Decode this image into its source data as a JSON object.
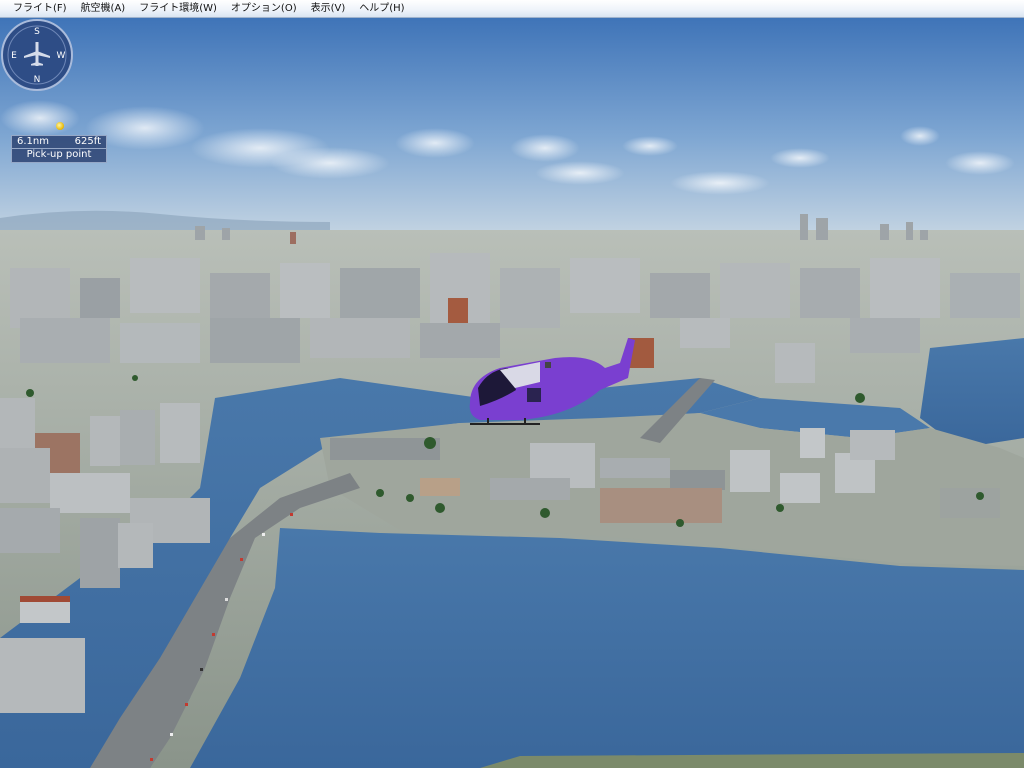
{
  "menubar": {
    "items": [
      {
        "label": "フライト(F)"
      },
      {
        "label": "航空機(A)"
      },
      {
        "label": "フライト環境(W)"
      },
      {
        "label": "オプション(O)"
      },
      {
        "label": "表示(V)"
      },
      {
        "label": "ヘルプ(H)"
      }
    ]
  },
  "hud": {
    "distance": "6.1nm",
    "altitude": "625ft",
    "target": "Pick-up point",
    "compass": {
      "north": "N",
      "south": "S",
      "east": "E",
      "west": "W",
      "icon": "airplane-icon"
    }
  },
  "colors": {
    "sky_top": "#4a7ec0",
    "sky_horizon": "#b8cde0",
    "water": "#3f6fa3",
    "city": "#a9aeb0",
    "helicopter": "#7a3fd0",
    "hud_bg": "#283e6e",
    "marker": "#e6b400"
  }
}
